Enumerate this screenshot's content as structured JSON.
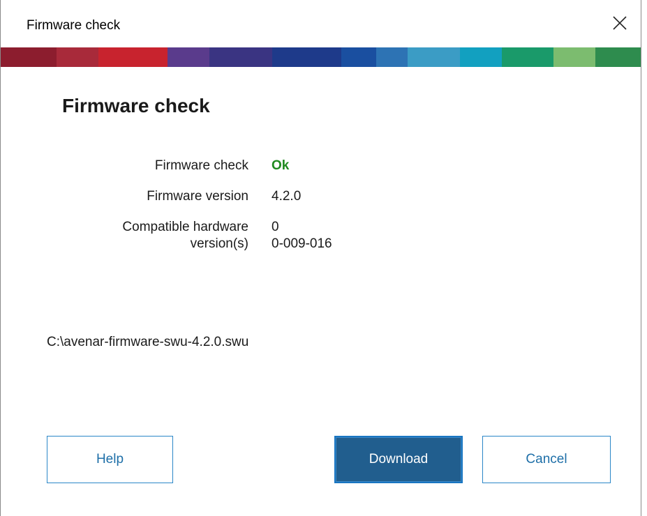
{
  "window": {
    "title": "Firmware check"
  },
  "colorbar": {
    "segments": [
      {
        "color": "#8c1d2e",
        "flex": 80
      },
      {
        "color": "#a82a3a",
        "flex": 60
      },
      {
        "color": "#c8232e",
        "flex": 100
      },
      {
        "color": "#5a3b8c",
        "flex": 60
      },
      {
        "color": "#3a3482",
        "flex": 90
      },
      {
        "color": "#1e3a8a",
        "flex": 100
      },
      {
        "color": "#1a4fa0",
        "flex": 50
      },
      {
        "color": "#2d73b4",
        "flex": 45
      },
      {
        "color": "#3b9cc5",
        "flex": 75
      },
      {
        "color": "#12a0c0",
        "flex": 60
      },
      {
        "color": "#1a9a6a",
        "flex": 75
      },
      {
        "color": "#7cbc6f",
        "flex": 60
      },
      {
        "color": "#2e8c4e",
        "flex": 65
      }
    ]
  },
  "content": {
    "heading": "Firmware check",
    "rows": [
      {
        "label": "Firmware check",
        "value": "Ok"
      },
      {
        "label": "Firmware version",
        "value": "4.2.0"
      },
      {
        "label_line1": "Compatible hardware",
        "label_line2": "version(s)",
        "value_line1": "0",
        "value_line2": "0-009-016"
      }
    ],
    "file_path": "C:\\avenar-firmware-swu-4.2.0.swu"
  },
  "buttons": {
    "help": "Help",
    "download": "Download",
    "cancel": "Cancel"
  },
  "colors": {
    "ok": "#1f8a1f",
    "accent": "#215e8e",
    "outline": "#2a86c8"
  },
  "icons": {
    "close": "close-icon"
  }
}
